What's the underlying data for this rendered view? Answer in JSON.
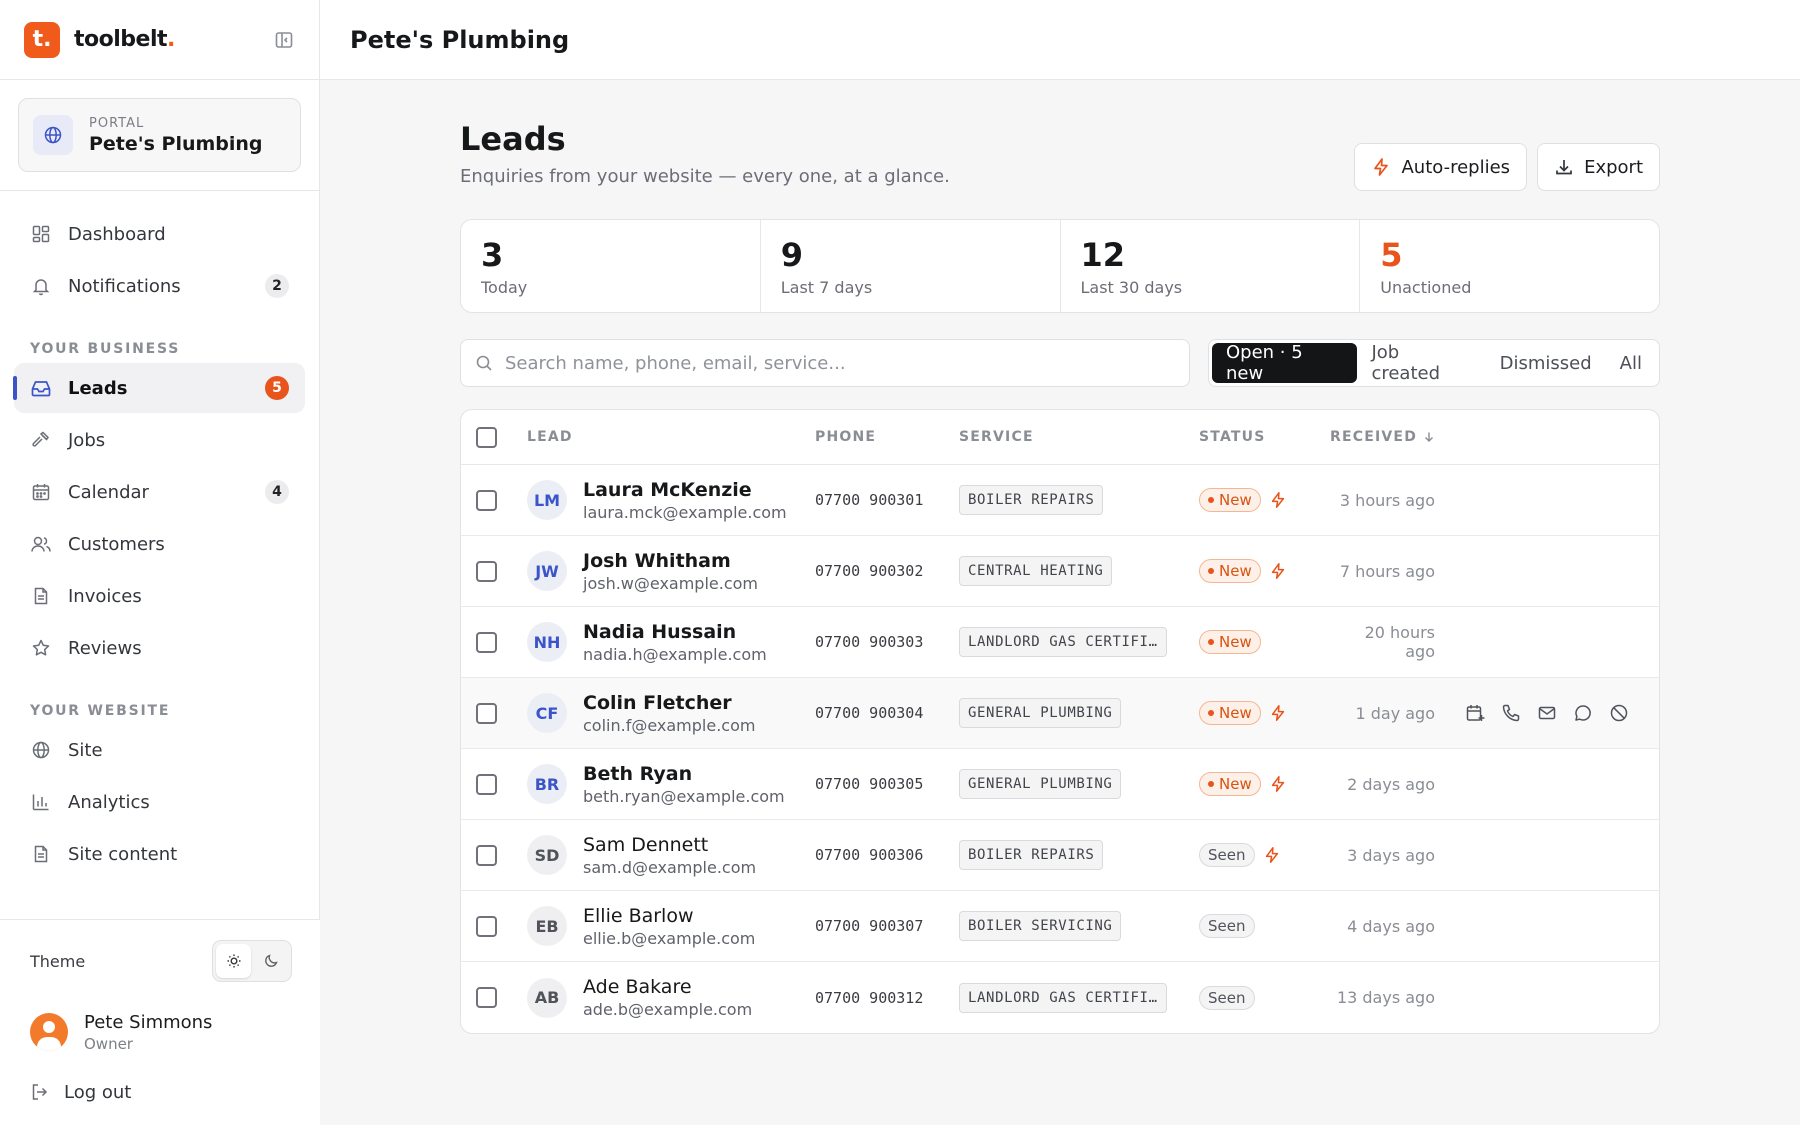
{
  "brand": {
    "logo_letter": "t.",
    "name": "toolbelt",
    "name_dot": "."
  },
  "portal": {
    "label": "PORTAL",
    "name": "Pete's Plumbing"
  },
  "nav_main": [
    {
      "label": "Dashboard",
      "icon": "dashboard-icon",
      "badge": ""
    },
    {
      "label": "Notifications",
      "icon": "bell-icon",
      "badge": "2"
    }
  ],
  "section_business": "YOUR BUSINESS",
  "nav_business": [
    {
      "label": "Leads",
      "icon": "inbox-icon",
      "badge": "5",
      "active": true
    },
    {
      "label": "Jobs",
      "icon": "hammer-icon",
      "badge": ""
    },
    {
      "label": "Calendar",
      "icon": "calendar-icon",
      "badge": "4"
    },
    {
      "label": "Customers",
      "icon": "users-icon",
      "badge": ""
    },
    {
      "label": "Invoices",
      "icon": "invoice-icon",
      "badge": ""
    },
    {
      "label": "Reviews",
      "icon": "star-icon",
      "badge": ""
    }
  ],
  "section_website": "YOUR WEBSITE",
  "nav_website": [
    {
      "label": "Site",
      "icon": "globe-icon"
    },
    {
      "label": "Analytics",
      "icon": "bar-chart-icon"
    },
    {
      "label": "Site content",
      "icon": "document-icon"
    }
  ],
  "theme": {
    "label": "Theme"
  },
  "user": {
    "name": "Pete Simmons",
    "role": "Owner"
  },
  "logout_label": "Log out",
  "topbar": {
    "title": "Pete's Plumbing"
  },
  "page": {
    "title": "Leads",
    "subtitle": "Enquiries from your website — every one, at a glance."
  },
  "actions": {
    "auto_replies": "Auto-replies",
    "export": "Export"
  },
  "stats": [
    {
      "value": "3",
      "label": "Today"
    },
    {
      "value": "9",
      "label": "Last 7 days"
    },
    {
      "value": "12",
      "label": "Last 30 days"
    },
    {
      "value": "5",
      "label": "Unactioned",
      "accent": true
    }
  ],
  "search": {
    "placeholder": "Search name, phone, email, service..."
  },
  "segments": [
    {
      "label": "Open · 5 new",
      "active": true
    },
    {
      "label": "Job created"
    },
    {
      "label": "Dismissed"
    },
    {
      "label": "All"
    }
  ],
  "table": {
    "columns": {
      "lead": "LEAD",
      "phone": "PHONE",
      "service": "SERVICE",
      "status": "STATUS",
      "received": "RECEIVED"
    },
    "rows": [
      {
        "initials": "LM",
        "name": "Laura McKenzie",
        "email": "laura.mck@example.com",
        "phone": "07700 900301",
        "service": "BOILER REPAIRS",
        "status": "New",
        "auto": true,
        "received": "3 hours ago"
      },
      {
        "initials": "JW",
        "name": "Josh Whitham",
        "email": "josh.w@example.com",
        "phone": "07700 900302",
        "service": "CENTRAL HEATING",
        "status": "New",
        "auto": true,
        "received": "7 hours ago"
      },
      {
        "initials": "NH",
        "name": "Nadia Hussain",
        "email": "nadia.h@example.com",
        "phone": "07700 900303",
        "service": "LANDLORD GAS CERTIFI…",
        "status": "New",
        "auto": false,
        "received": "20 hours ago"
      },
      {
        "initials": "CF",
        "name": "Colin Fletcher",
        "email": "colin.f@example.com",
        "phone": "07700 900304",
        "service": "GENERAL PLUMBING",
        "status": "New",
        "auto": true,
        "received": "1 day ago",
        "hover": true
      },
      {
        "initials": "BR",
        "name": "Beth Ryan",
        "email": "beth.ryan@example.com",
        "phone": "07700 900305",
        "service": "GENERAL PLUMBING",
        "status": "New",
        "auto": true,
        "received": "2 days ago"
      },
      {
        "initials": "SD",
        "name": "Sam Dennett",
        "email": "sam.d@example.com",
        "phone": "07700 900306",
        "service": "BOILER REPAIRS",
        "status": "Seen",
        "auto": true,
        "received": "3 days ago"
      },
      {
        "initials": "EB",
        "name": "Ellie Barlow",
        "email": "ellie.b@example.com",
        "phone": "07700 900307",
        "service": "BOILER SERVICING",
        "status": "Seen",
        "auto": false,
        "received": "4 days ago"
      },
      {
        "initials": "AB",
        "name": "Ade Bakare",
        "email": "ade.b@example.com",
        "phone": "07700 900312",
        "service": "LANDLORD GAS CERTIFI…",
        "status": "Seen",
        "auto": false,
        "received": "13 days ago"
      }
    ]
  },
  "row_actions": [
    "calendar-plus-icon",
    "phone-icon",
    "mail-icon",
    "chat-icon",
    "ban-icon"
  ],
  "colors": {
    "accent": "#e8541c",
    "brand": "#f05a1a",
    "indigo": "#3b55c9",
    "dark": "#141517"
  }
}
